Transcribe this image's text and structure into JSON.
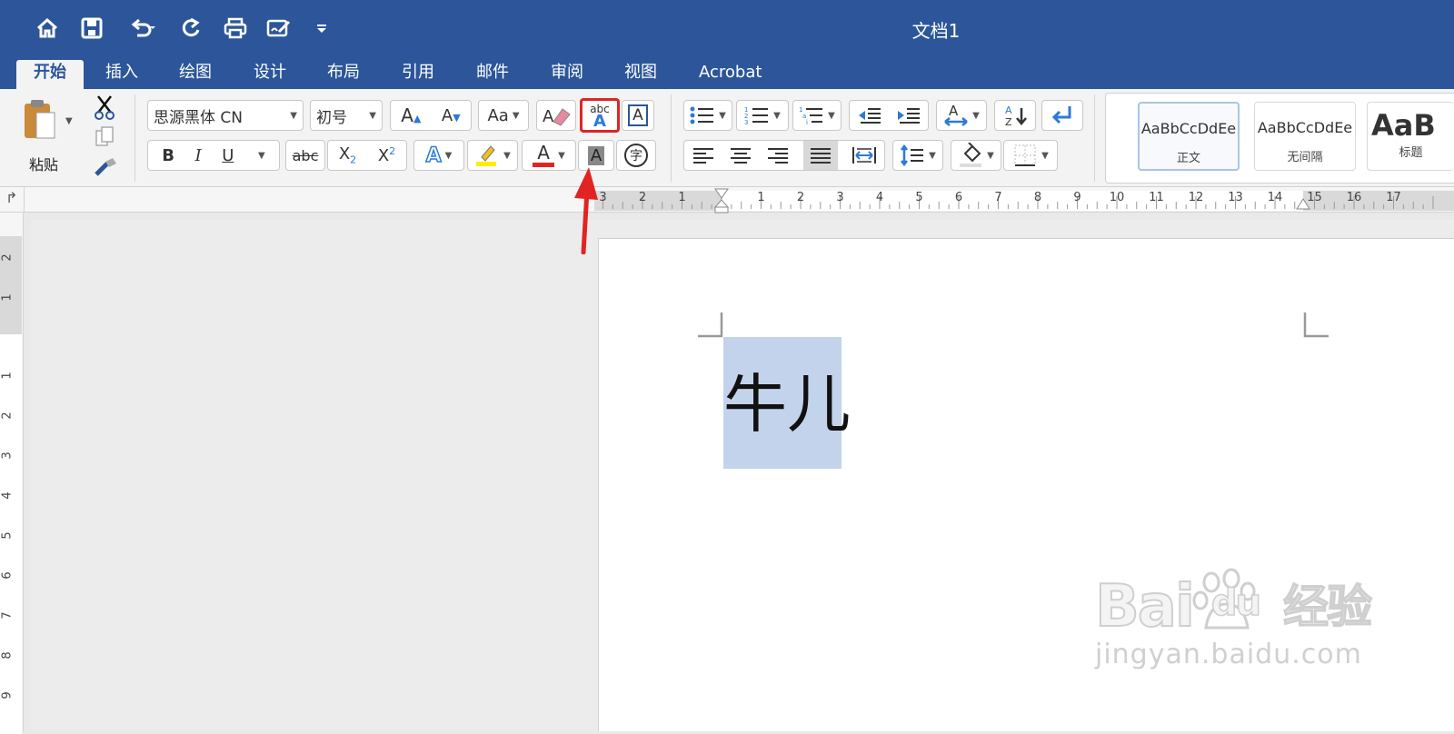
{
  "window": {
    "title": "文档1"
  },
  "quick_access": [
    {
      "name": "home-icon"
    },
    {
      "name": "save-icon"
    },
    {
      "name": "undo-icon"
    },
    {
      "name": "redo-icon"
    },
    {
      "name": "print-icon"
    },
    {
      "name": "edit-doc-icon"
    },
    {
      "name": "customize-icon"
    }
  ],
  "tabs": [
    "开始",
    "插入",
    "绘图",
    "设计",
    "布局",
    "引用",
    "邮件",
    "审阅",
    "视图",
    "Acrobat"
  ],
  "ribbon": {
    "paste_label": "粘贴",
    "font_name": "思源黑体 CN",
    "font_size": "初号",
    "bold": "B",
    "italic": "I",
    "underline": "U",
    "strike": "abc",
    "subscript_base": "X",
    "subscript_mark": "2",
    "superscript_base": "X",
    "superscript_mark": "2",
    "grow_font": "A",
    "shrink_font": "A",
    "change_case": "Aa",
    "phonetic_top": "abc",
    "phonetic_bottom": "A",
    "char_border": "A",
    "effects": "A",
    "highlight": "A",
    "font_color": "A",
    "shading": "A",
    "enclose": "字"
  },
  "styles": [
    {
      "sample": "AaBbCcDdEe",
      "name": "正文"
    },
    {
      "sample": "AaBbCcDdEe",
      "name": "无间隔"
    },
    {
      "sample": "AaB",
      "name": "标题"
    }
  ],
  "ruler": {
    "h_left": [
      "3",
      "2",
      "1"
    ],
    "h_right": [
      "1",
      "2",
      "3",
      "4",
      "5",
      "6",
      "7",
      "8",
      "9",
      "10",
      "11",
      "12",
      "13",
      "14",
      "15",
      "16",
      "17"
    ],
    "v_top": [
      "2",
      "1"
    ],
    "v_bottom": [
      "1",
      "2",
      "3",
      "4",
      "5",
      "6",
      "7",
      "8",
      "9"
    ]
  },
  "document": {
    "text": "牛儿"
  },
  "watermark": {
    "brand": "Bai",
    "brand2": "du",
    "cn": "经验",
    "url": "jingyan.baidu.com"
  },
  "colors": {
    "titlebar": "#2c5699",
    "accent_red": "#e02424",
    "selection": "#c4d3ec"
  }
}
